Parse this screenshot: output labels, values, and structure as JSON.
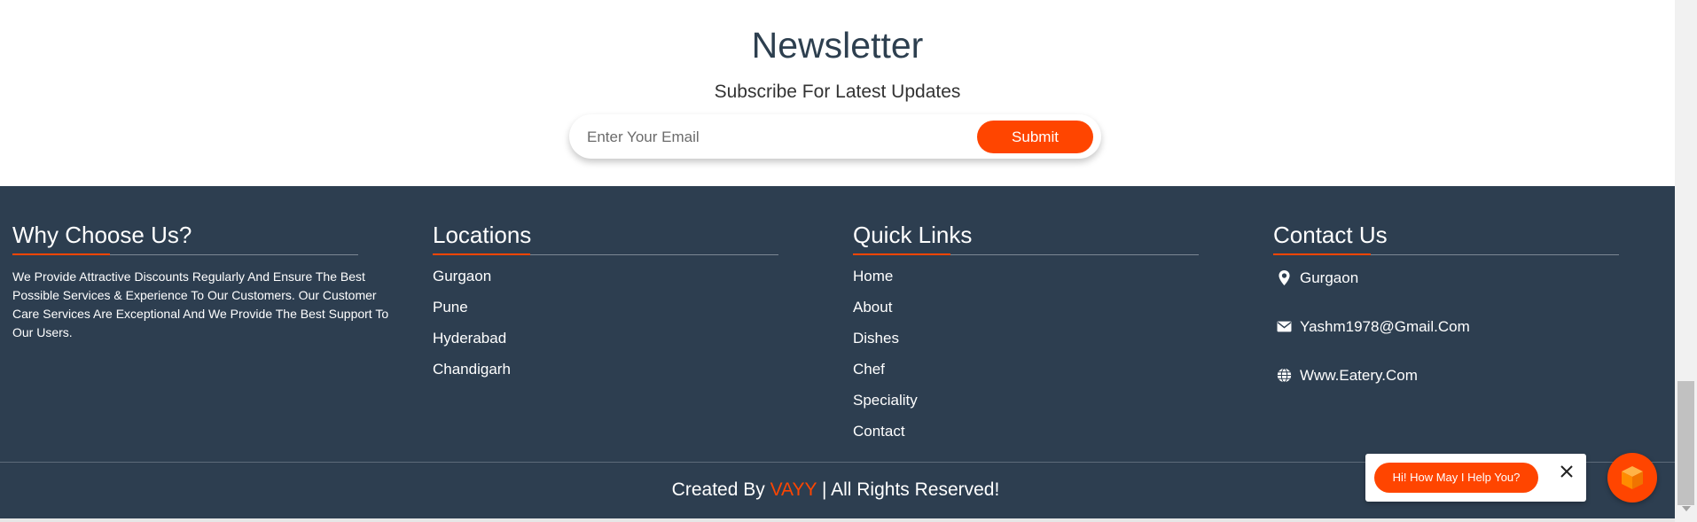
{
  "newsletter": {
    "title": "Newsletter",
    "subtitle": "Subscribe For Latest Updates",
    "email_placeholder": "Enter Your Email",
    "submit_label": "Submit"
  },
  "footer": {
    "why": {
      "heading": "Why Choose Us?",
      "text": "We Provide Attractive Discounts Regularly And Ensure The Best Possible Services & Experience To Our Customers. Our Customer Care Services Are Exceptional And We Provide The Best Support To Our Users."
    },
    "locations": {
      "heading": "Locations",
      "items": [
        "Gurgaon",
        "Pune",
        "Hyderabad",
        "Chandigarh"
      ]
    },
    "quick_links": {
      "heading": "Quick Links",
      "items": [
        "Home",
        "About",
        "Dishes",
        "Chef",
        "Speciality",
        "Contact"
      ]
    },
    "contact": {
      "heading": "Contact Us",
      "location": "Gurgaon",
      "email": "Yashm1978@Gmail.Com",
      "website": "Www.Eatery.Com"
    },
    "credit": {
      "prefix": "Created By",
      "brand": "VAYY",
      "suffix": "| All Rights Reserved!"
    }
  },
  "chat": {
    "prompt": "Hi! How May I Help You?"
  },
  "colors": {
    "accent": "#ff4500",
    "footer_bg": "#2d3e50"
  },
  "icons": [
    "map-pin-icon",
    "envelope-icon",
    "globe-icon",
    "close-icon",
    "cube-icon"
  ]
}
